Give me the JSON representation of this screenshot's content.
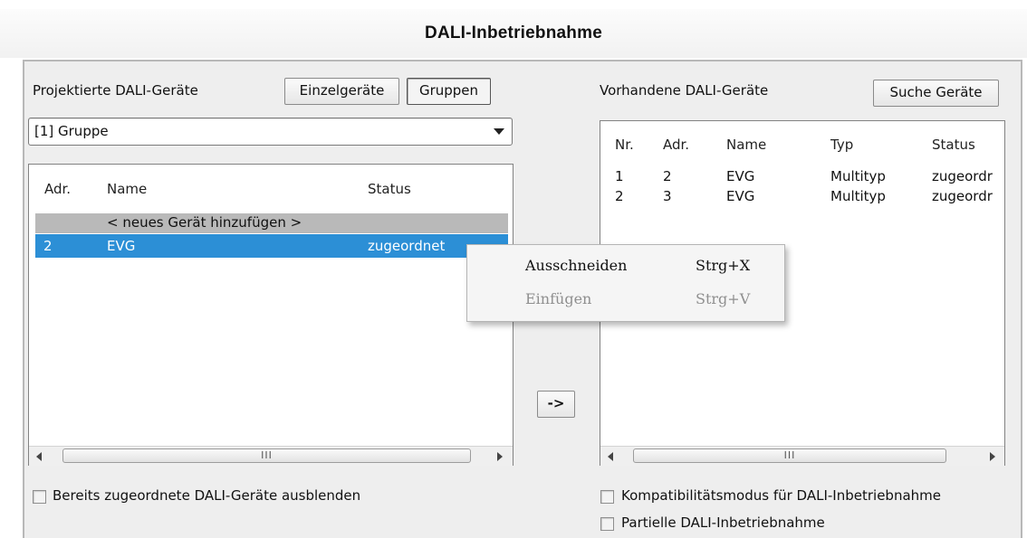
{
  "window": {
    "title": "DALI-Inbetriebnahme"
  },
  "left": {
    "heading": "Projektierte DALI-Geräte",
    "toggle_buttons": {
      "single_devices": "Einzelgeräte",
      "groups": "Gruppen",
      "selected": "groups"
    },
    "group_select": {
      "value": "[1] Gruppe"
    },
    "table": {
      "headers": {
        "addr": "Adr.",
        "name": "Name",
        "status": "Status"
      },
      "add_row_label": "< neues Gerät hinzufügen >",
      "rows": [
        {
          "addr": "2",
          "name": "EVG",
          "status": "zugeordnet",
          "selected": true
        }
      ]
    },
    "scrollbar_thumb_glyph": "III",
    "hide_assigned_checkbox": {
      "label": "Bereits zugeordnete DALI-Geräte ausblenden",
      "checked": false
    }
  },
  "transfer_button": {
    "label": "->"
  },
  "right": {
    "heading": "Vorhandene DALI-Geräte",
    "search_button": "Suche Geräte",
    "table": {
      "headers": {
        "nr": "Nr.",
        "addr": "Adr.",
        "name": "Name",
        "type": "Typ",
        "status": "Status"
      },
      "rows": [
        {
          "nr": "1",
          "addr": "2",
          "name": "EVG",
          "type": "Multityp",
          "status": "zugeordr"
        },
        {
          "nr": "2",
          "addr": "3",
          "name": "EVG",
          "type": "Multityp",
          "status": "zugeordr"
        }
      ]
    },
    "scrollbar_thumb_glyph": "III",
    "compat_checkbox": {
      "label": "Kompatibilitätsmodus für DALI-Inbetriebnahme",
      "checked": false
    },
    "partial_checkbox": {
      "label": "Partielle DALI-Inbetriebnahme",
      "checked": false
    }
  },
  "context_menu": {
    "items": [
      {
        "label": "Ausschneiden",
        "shortcut": "Strg+X",
        "enabled": true
      },
      {
        "label": "Einfügen",
        "shortcut": "Strg+V",
        "enabled": false
      }
    ]
  },
  "colors": {
    "selection": "#2c8fd6",
    "add_row_bg": "#b9b9b9",
    "dialog_bg": "#eeeeee"
  }
}
